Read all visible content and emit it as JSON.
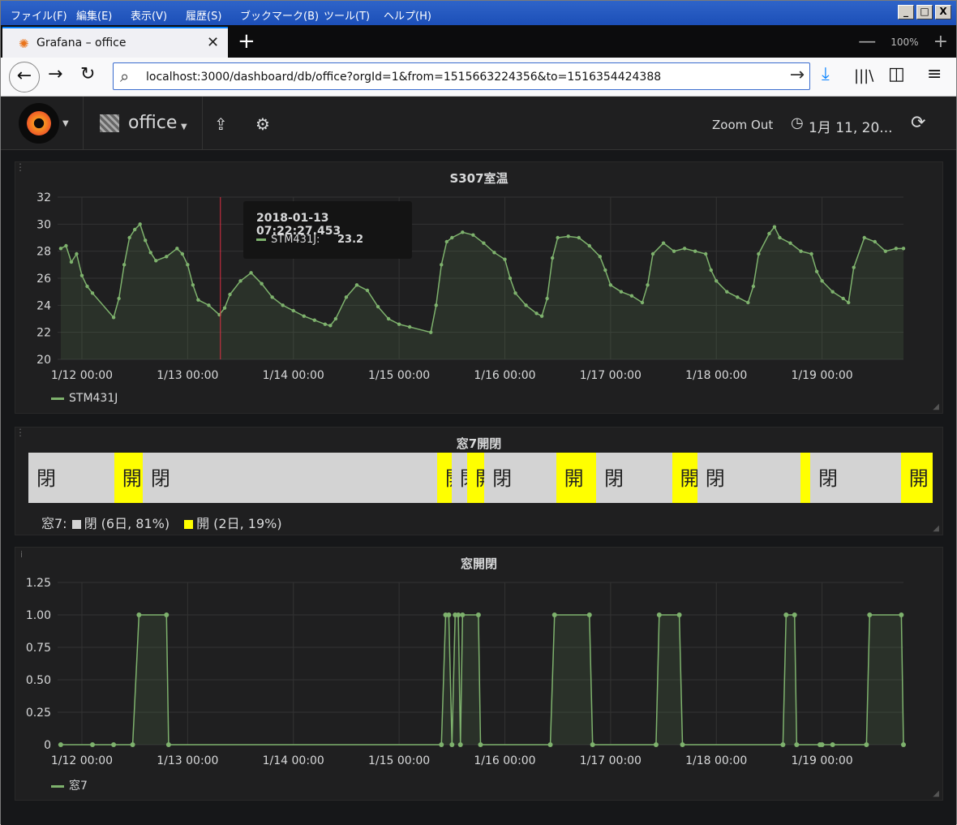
{
  "menu": {
    "items": [
      "ファイル(F)",
      "編集(E)",
      "表示(V)",
      "履歴(S)",
      "ブックマーク(B)",
      "ツール(T)",
      "ヘルプ(H)"
    ],
    "window_controls": [
      "_",
      "□",
      "X"
    ]
  },
  "browser": {
    "tab_title": "Grafana – office",
    "tab_close": "✕",
    "new_tab": "+",
    "zoom_level": "100%",
    "zoom_minus": "—",
    "zoom_plus": "+",
    "url": "localhost:3000/dashboard/db/office?orgId=1&from=1515663224356&to=1516354424388",
    "icons": [
      "back-arrow-icon",
      "forward-arrow-icon",
      "reload-icon",
      "search-icon",
      "go-arrow-icon",
      "download-icon",
      "library-icon",
      "sidebar-icon",
      "menu-icon"
    ]
  },
  "grafana": {
    "dashboard_title": "office",
    "zoom_out": "Zoom Out",
    "time_range": "1月 11, 20...",
    "colors": {
      "series": "#7eb26d",
      "closed": "#d3d3d3",
      "open": "#ffff00",
      "crosshair": "#e02f44"
    }
  },
  "panel1": {
    "title": "S307室温",
    "legend": "STM431J",
    "tooltip": {
      "time": "2018-01-13 07:22:27.453",
      "series": "STM431J:",
      "value": "23.2"
    }
  },
  "panel2": {
    "title": "窓7開閉",
    "legend_label": "窓7:",
    "legend_closed": "閉 (6日, 81%)",
    "legend_open": "開 (2日, 19%)",
    "closed_label": "閉",
    "open_label": "開",
    "segments": [
      {
        "state": "closed",
        "start": 0,
        "end": 0.0948
      },
      {
        "state": "open",
        "start": 0.0948,
        "end": 0.1264
      },
      {
        "state": "closed",
        "start": 0.1264,
        "end": 0.4519
      },
      {
        "state": "open",
        "start": 0.4519,
        "end": 0.4681
      },
      {
        "state": "closed",
        "start": 0.4681,
        "end": 0.4852
      },
      {
        "state": "open",
        "start": 0.4852,
        "end": 0.5041
      },
      {
        "state": "closed",
        "start": 0.5041,
        "end": 0.5835
      },
      {
        "state": "open",
        "start": 0.5835,
        "end": 0.6278
      },
      {
        "state": "closed",
        "start": 0.6278,
        "end": 0.7117
      },
      {
        "state": "open",
        "start": 0.7117,
        "end": 0.7397
      },
      {
        "state": "closed",
        "start": 0.7397,
        "end": 0.8538
      },
      {
        "state": "open",
        "start": 0.8538,
        "end": 0.8646
      },
      {
        "state": "closed",
        "start": 0.8646,
        "end": 0.9648
      },
      {
        "state": "open",
        "start": 0.9648,
        "end": 1.0
      }
    ]
  },
  "panel3": {
    "title": "窓開閉",
    "legend": "窓7"
  },
  "chart_data": [
    {
      "type": "line",
      "title": "S307室温",
      "ylim": [
        20,
        32
      ],
      "yticks": [
        "20",
        "22",
        "24",
        "26",
        "28",
        "30",
        "32"
      ],
      "xticks": [
        "1/12 00:00",
        "1/13 00:00",
        "1/14 00:00",
        "1/15 00:00",
        "1/16 00:00",
        "1/17 00:00",
        "1/18 00:00",
        "1/19 00:00"
      ],
      "xlim": [
        -0.23,
        7.77
      ],
      "x_unit": "days since 1/12 00:00",
      "series": [
        {
          "name": "STM431J",
          "points": [
            [
              -0.2,
              28.2
            ],
            [
              -0.15,
              28.4
            ],
            [
              -0.1,
              27.2
            ],
            [
              -0.05,
              27.8
            ],
            [
              0.0,
              26.2
            ],
            [
              0.05,
              25.4
            ],
            [
              0.1,
              24.9
            ],
            [
              0.3,
              23.1
            ],
            [
              0.35,
              24.5
            ],
            [
              0.4,
              27.0
            ],
            [
              0.45,
              29.0
            ],
            [
              0.5,
              29.6
            ],
            [
              0.55,
              30.0
            ],
            [
              0.6,
              28.8
            ],
            [
              0.65,
              27.9
            ],
            [
              0.7,
              27.3
            ],
            [
              0.8,
              27.6
            ],
            [
              0.9,
              28.2
            ],
            [
              0.95,
              27.8
            ],
            [
              1.0,
              27.0
            ],
            [
              1.05,
              25.5
            ],
            [
              1.1,
              24.4
            ],
            [
              1.2,
              24.0
            ],
            [
              1.3,
              23.3
            ],
            [
              1.35,
              23.8
            ],
            [
              1.4,
              24.8
            ],
            [
              1.5,
              25.8
            ],
            [
              1.6,
              26.4
            ],
            [
              1.7,
              25.6
            ],
            [
              1.8,
              24.6
            ],
            [
              1.9,
              24.0
            ],
            [
              2.0,
              23.6
            ],
            [
              2.1,
              23.2
            ],
            [
              2.2,
              22.9
            ],
            [
              2.3,
              22.6
            ],
            [
              2.35,
              22.5
            ],
            [
              2.4,
              23.0
            ],
            [
              2.5,
              24.6
            ],
            [
              2.6,
              25.5
            ],
            [
              2.7,
              25.1
            ],
            [
              2.8,
              23.9
            ],
            [
              2.9,
              23.0
            ],
            [
              3.0,
              22.6
            ],
            [
              3.1,
              22.4
            ],
            [
              3.3,
              22.0
            ],
            [
              3.35,
              24.0
            ],
            [
              3.4,
              27.0
            ],
            [
              3.45,
              28.7
            ],
            [
              3.5,
              29.0
            ],
            [
              3.6,
              29.4
            ],
            [
              3.7,
              29.2
            ],
            [
              3.8,
              28.6
            ],
            [
              3.9,
              27.9
            ],
            [
              4.0,
              27.4
            ],
            [
              4.05,
              26.0
            ],
            [
              4.1,
              24.9
            ],
            [
              4.2,
              24.0
            ],
            [
              4.3,
              23.4
            ],
            [
              4.35,
              23.2
            ],
            [
              4.4,
              24.5
            ],
            [
              4.45,
              27.5
            ],
            [
              4.5,
              29.0
            ],
            [
              4.6,
              29.1
            ],
            [
              4.7,
              29.0
            ],
            [
              4.8,
              28.4
            ],
            [
              4.9,
              27.6
            ],
            [
              4.95,
              26.6
            ],
            [
              5.0,
              25.5
            ],
            [
              5.1,
              25.0
            ],
            [
              5.2,
              24.7
            ],
            [
              5.3,
              24.2
            ],
            [
              5.35,
              25.5
            ],
            [
              5.4,
              27.8
            ],
            [
              5.5,
              28.6
            ],
            [
              5.6,
              28.0
            ],
            [
              5.7,
              28.2
            ],
            [
              5.8,
              28.0
            ],
            [
              5.9,
              27.8
            ],
            [
              5.95,
              26.6
            ],
            [
              6.0,
              25.8
            ],
            [
              6.1,
              25.0
            ],
            [
              6.2,
              24.6
            ],
            [
              6.3,
              24.2
            ],
            [
              6.35,
              25.4
            ],
            [
              6.4,
              27.8
            ],
            [
              6.5,
              29.3
            ],
            [
              6.55,
              29.8
            ],
            [
              6.6,
              29.0
            ],
            [
              6.7,
              28.6
            ],
            [
              6.8,
              28.0
            ],
            [
              6.9,
              27.8
            ],
            [
              6.95,
              26.5
            ],
            [
              7.0,
              25.8
            ],
            [
              7.1,
              25.0
            ],
            [
              7.2,
              24.5
            ],
            [
              7.25,
              24.2
            ],
            [
              7.3,
              26.8
            ],
            [
              7.4,
              29.0
            ],
            [
              7.5,
              28.7
            ],
            [
              7.6,
              28.0
            ],
            [
              7.7,
              28.2
            ],
            [
              7.77,
              28.2
            ]
          ]
        }
      ]
    },
    {
      "type": "line",
      "title": "窓開閉",
      "ylim": [
        0,
        1.25
      ],
      "yticks": [
        "0",
        "0.25",
        "0.50",
        "0.75",
        "1.00",
        "1.25"
      ],
      "xticks": [
        "1/12 00:00",
        "1/13 00:00",
        "1/14 00:00",
        "1/15 00:00",
        "1/16 00:00",
        "1/17 00:00",
        "1/18 00:00",
        "1/19 00:00"
      ],
      "xlim": [
        -0.23,
        7.77
      ],
      "x_unit": "days since 1/12 00:00",
      "series": [
        {
          "name": "窓7",
          "points": [
            [
              -0.2,
              0
            ],
            [
              0.1,
              0
            ],
            [
              0.3,
              0
            ],
            [
              0.48,
              0
            ],
            [
              0.54,
              1
            ],
            [
              0.8,
              1
            ],
            [
              0.82,
              0
            ],
            [
              3.4,
              0
            ],
            [
              3.44,
              1
            ],
            [
              3.47,
              1
            ],
            [
              3.5,
              0
            ],
            [
              3.53,
              1
            ],
            [
              3.56,
              1
            ],
            [
              3.58,
              0
            ],
            [
              3.6,
              1
            ],
            [
              3.75,
              1
            ],
            [
              3.77,
              0
            ],
            [
              4.43,
              0
            ],
            [
              4.47,
              1
            ],
            [
              4.8,
              1
            ],
            [
              4.83,
              0
            ],
            [
              5.43,
              0
            ],
            [
              5.46,
              1
            ],
            [
              5.65,
              1
            ],
            [
              5.68,
              0
            ],
            [
              6.63,
              0
            ],
            [
              6.66,
              1
            ],
            [
              6.74,
              1
            ],
            [
              6.76,
              0
            ],
            [
              6.98,
              0
            ],
            [
              7.0,
              0
            ],
            [
              7.1,
              0
            ],
            [
              7.42,
              0
            ],
            [
              7.45,
              1
            ],
            [
              7.75,
              1
            ],
            [
              7.77,
              0
            ]
          ]
        }
      ]
    }
  ]
}
